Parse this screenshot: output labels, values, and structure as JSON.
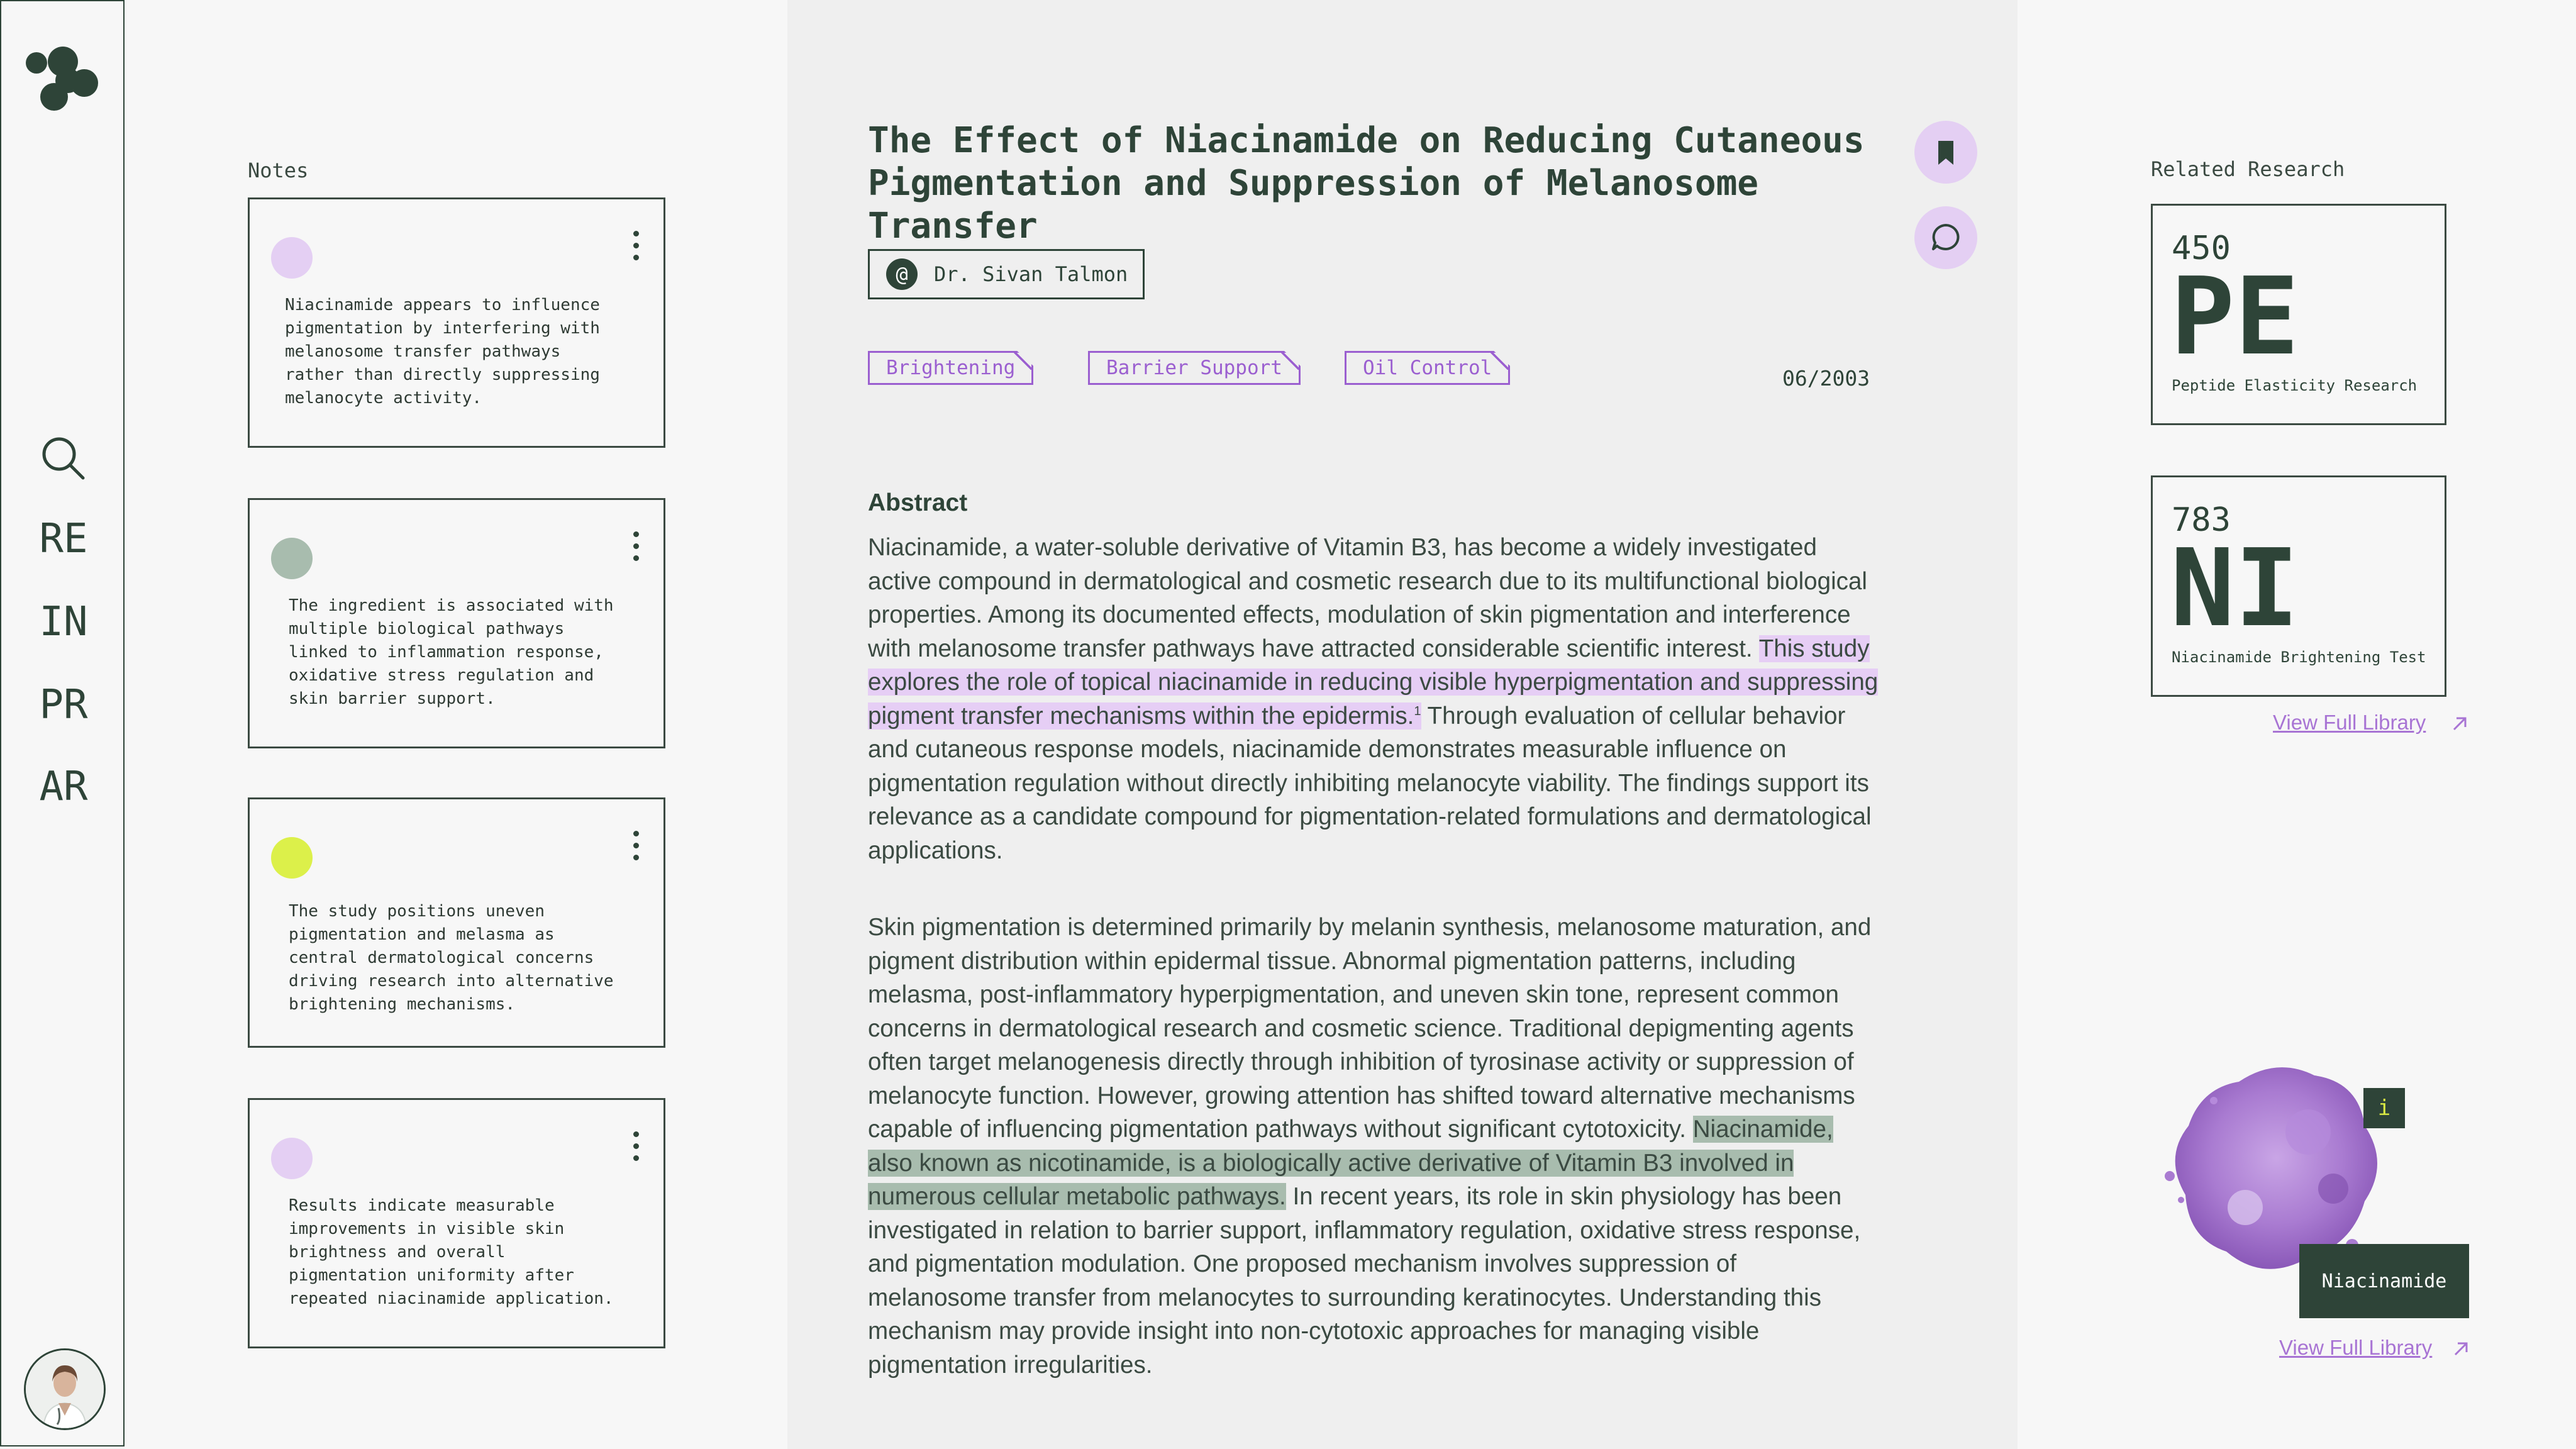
{
  "sidebar": {
    "nav": [
      {
        "label": "RE"
      },
      {
        "label": "IN"
      },
      {
        "label": "PR"
      },
      {
        "label": "AR"
      }
    ]
  },
  "notes": {
    "label": "Notes",
    "items": [
      {
        "color": "#e4cff3",
        "text": "Niacinamide appears to influence\npigmentation by interfering with\nmelanosome transfer pathways\nrather than directly suppressing\nmelanocyte activity."
      },
      {
        "color": "#a8bcae",
        "text": "The ingredient is associated with\nmultiple biological pathways\nlinked to inflammation response,\noxidative stress regulation and\nskin barrier support."
      },
      {
        "color": "#dcf04a",
        "text": "The study positions uneven\npigmentation and melasma as\ncentral dermatological concerns\ndriving research into alternative\nbrightening mechanisms."
      },
      {
        "color": "#e4cff3",
        "text": "Results indicate measurable\nimprovements in visible skin\nbrightness and overall\npigmentation uniformity after\nrepeated niacinamide application."
      }
    ]
  },
  "article": {
    "title": "The Effect of Niacinamide on Reducing Cutaneous Pigmentation and Suppression of Melanosome Transfer",
    "author_icon": "@",
    "author": "Dr. Sivan Talmon",
    "tags": [
      "Brightening",
      "Barrier Support",
      "Oil Control"
    ],
    "date": "06/2003",
    "abstract_heading": "Abstract",
    "abstract": {
      "part1": "Niacinamide, a water-soluble derivative of Vitamin B3, has become a widely investigated active compound in dermatological and cosmetic research due to its multifunctional biological properties. Among its documented effects, modulation of skin pigmentation and interference with melanosome transfer pathways have attracted considerable scientific interest.",
      "highlight": "This study explores the role of topical niacinamide in reducing visible hyperpigmentation and suppressing pigment transfer mechanisms within the epidermis.",
      "footnote": "1",
      "part2": "Through evaluation of cellular behavior and cutaneous response models, niacinamide demonstrates measurable influence on pigmentation regulation without directly inhibiting melanocyte viability. The findings support its relevance as a candidate compound for pigmentation-related formulations and dermatological applications."
    },
    "body": {
      "part1": "Skin pigmentation is determined primarily by melanin synthesis, melanosome maturation, and pigment distribution within epidermal tissue. Abnormal pigmentation patterns, including melasma, post-inflammatory hyperpigmentation, and uneven skin tone, represent common concerns in dermatological research and cosmetic science. Traditional depigmenting agents often target melanogenesis directly through inhibition of tyrosinase activity or suppression of melanocyte function. However, growing attention has shifted toward alternative mechanisms capable of influencing pigmentation pathways without significant cytotoxicity.",
      "highlight": "Niacinamide, also known as nicotinamide, is a biologically active derivative of Vitamin B3 involved in numerous cellular metabolic pathways.",
      "part2": "In recent years, its role in skin physiology has been investigated in relation to barrier support, inflammatory regulation, oxidative stress response, and pigmentation modulation. One proposed mechanism involves suppression of melanosome transfer from melanocytes to surrounding keratinocytes. Understanding this mechanism may provide insight into non-cytotoxic approaches for managing visible pigmentation irregularities."
    }
  },
  "related": {
    "label": "Related Research",
    "items": [
      {
        "number": "450",
        "symbol": "PE",
        "name": "Peptide Elasticity Research"
      },
      {
        "number": "783",
        "symbol": "NI",
        "name": "Niacinamide Brightening Test"
      }
    ],
    "link_label": "View Full Library"
  },
  "ingredient": {
    "info_label": "i",
    "name": "Niacinamide",
    "link_label": "View Full Library"
  },
  "colors": {
    "accent_green": "#2e4438",
    "accent_purple": "#9b5fd0",
    "highlight_purple": "#e6cef5",
    "highlight_green": "#a8bcae"
  }
}
